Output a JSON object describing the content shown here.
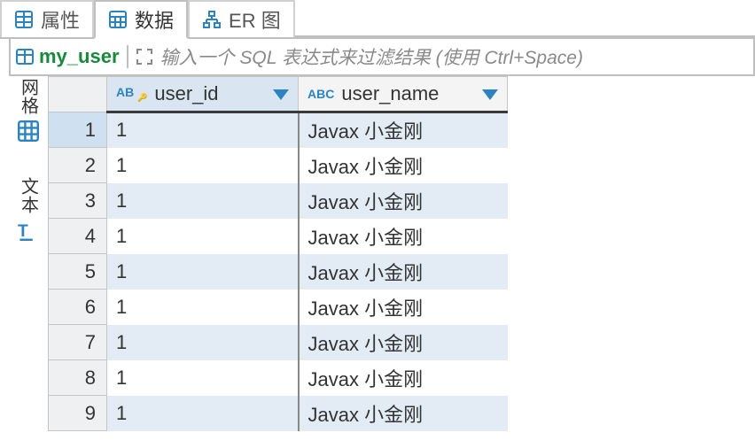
{
  "tabs": [
    {
      "label": "属性",
      "active": false
    },
    {
      "label": "数据",
      "active": true
    },
    {
      "label": "ER 图",
      "active": false
    }
  ],
  "table_name": "my_user",
  "filter_placeholder": "输入一个 SQL 表达式来过滤结果 (使用 Ctrl+Space)",
  "side_rail": {
    "grid_label": "网格",
    "text_label": "文本"
  },
  "columns": [
    {
      "name": "user_id",
      "type_icon": "ABC_key"
    },
    {
      "name": "user_name",
      "type_icon": "ABC"
    }
  ],
  "rows": [
    {
      "n": "1",
      "user_id": "1",
      "user_name": "Javax 小金刚",
      "selected": true
    },
    {
      "n": "2",
      "user_id": "1",
      "user_name": "Javax 小金刚"
    },
    {
      "n": "3",
      "user_id": "1",
      "user_name": "Javax 小金刚"
    },
    {
      "n": "4",
      "user_id": "1",
      "user_name": "Javax 小金刚"
    },
    {
      "n": "5",
      "user_id": "1",
      "user_name": "Javax 小金刚"
    },
    {
      "n": "6",
      "user_id": "1",
      "user_name": "Javax 小金刚"
    },
    {
      "n": "7",
      "user_id": "1",
      "user_name": "Javax 小金刚"
    },
    {
      "n": "8",
      "user_id": "1",
      "user_name": "Javax 小金刚"
    },
    {
      "n": "9",
      "user_id": "1",
      "user_name": "Javax 小金刚"
    }
  ]
}
